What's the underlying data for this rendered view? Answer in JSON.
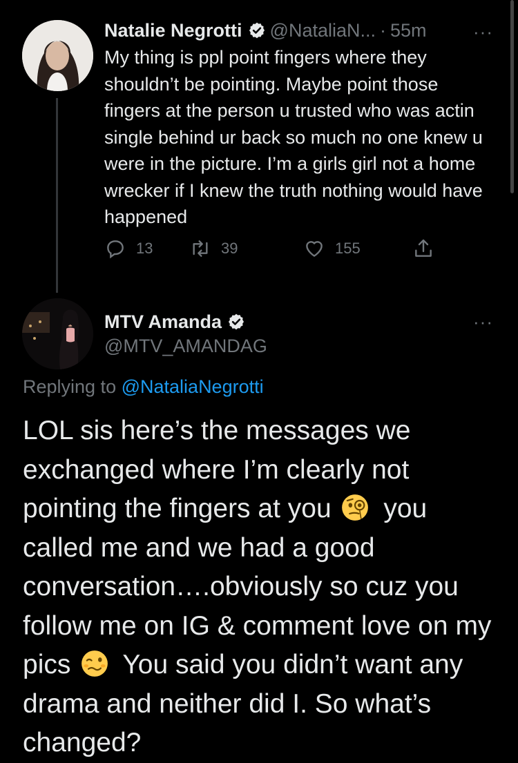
{
  "colors": {
    "background": "#000000",
    "text": "#e7e9ea",
    "muted": "#71767b",
    "link": "#1d9bf0",
    "verified": "#e7e9ea"
  },
  "tweet1": {
    "name": "Natalie Negrotti",
    "handle": "@NataliaN...",
    "separator": "·",
    "time": "55m",
    "more": "···",
    "text": "My thing is ppl point fingers where they shouldn’t be pointing. Maybe point those fingers at the person u trusted who was actin single behind ur back so much no one knew u were in the picture. I’m a girls girl not a home wrecker if I knew the truth nothing would have happened",
    "replies": "13",
    "retweets": "39",
    "likes": "155",
    "icons": [
      "reply-icon",
      "retweet-icon",
      "like-icon",
      "share-icon"
    ]
  },
  "tweet2": {
    "name": "MTV Amanda",
    "handle": "@MTV_AMANDAG",
    "more": "···",
    "replying_prefix": "Replying to",
    "replying_to": "@NataliaNegrotti",
    "text_part1": "LOL sis here’s the messages we exchanged where I’m clearly not pointing the fingers at you",
    "emoji1": "face-with-monocle-emoji",
    "text_part2": "you called me and we had a good conversation….obviously so cuz you follow me on IG & comment love on my pics",
    "emoji2": "woozy-face-emoji",
    "text_part3": "You said you didn’t want any drama and neither did I. So what’s changed?"
  }
}
